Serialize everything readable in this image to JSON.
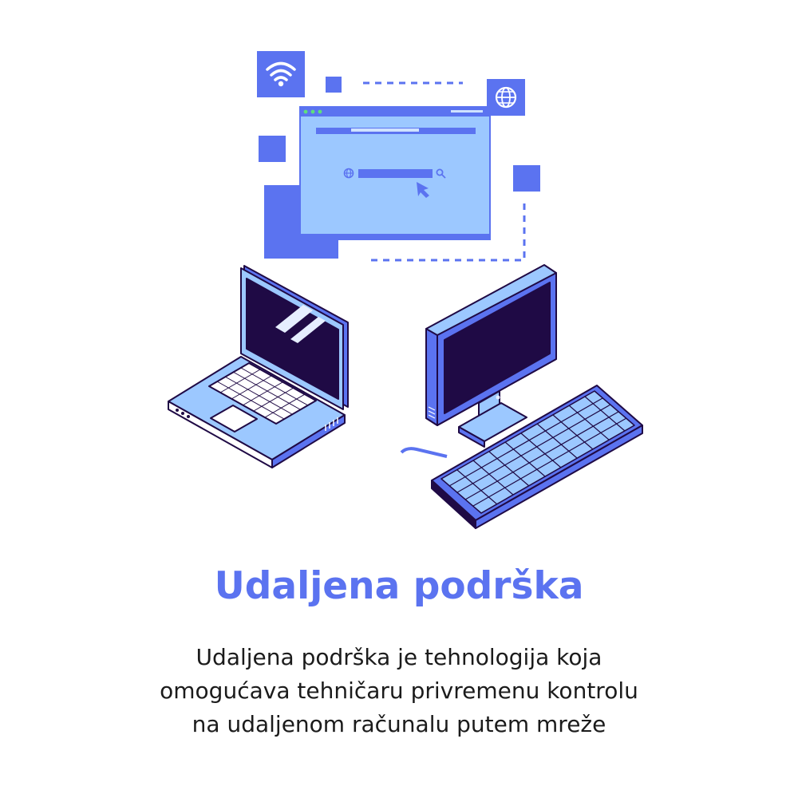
{
  "title": "Udaljena podrška",
  "description_lines": [
    "Udaljena podrška je tehnologija koja",
    "omogućava tehničaru privremenu kontrolu",
    "na udaljenom računalu putem mreže"
  ],
  "colors": {
    "accent": "#5b73f0",
    "text": "#1b1b1b",
    "light_blue": "#9cc8ff",
    "dark_screen": "#1f0a45",
    "background": "#ffffff"
  },
  "icons": [
    "wifi-icon",
    "globe-icon",
    "search-icon",
    "cursor-icon"
  ]
}
